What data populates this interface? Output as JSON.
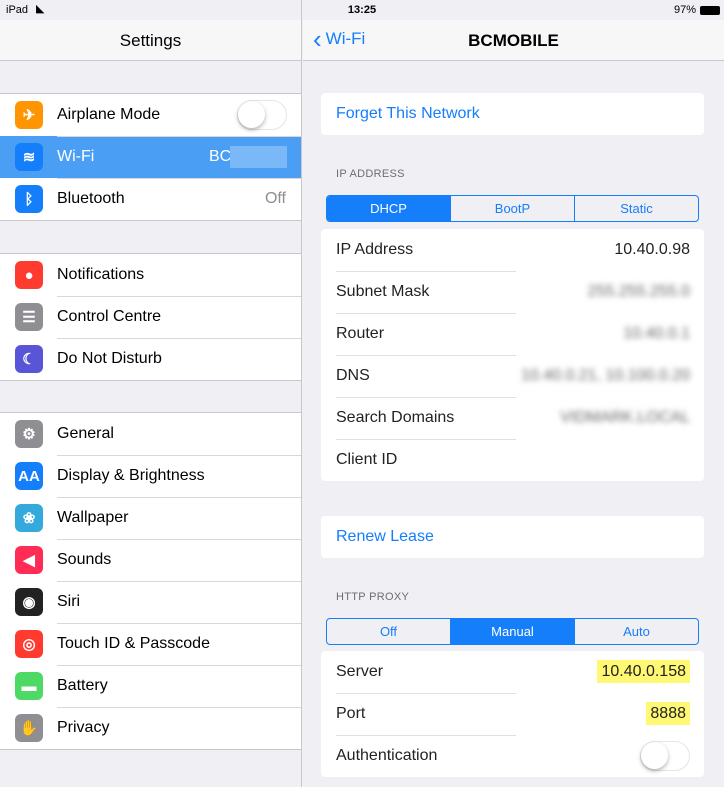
{
  "status": {
    "device": "iPad",
    "time": "13:25",
    "battery": "97%"
  },
  "left": {
    "title": "Settings",
    "groups": [
      [
        {
          "label": "Airplane Mode",
          "icon": "airplane-icon",
          "color": "#ff9500",
          "toggle": false
        },
        {
          "label": "Wi-Fi",
          "icon": "wifi-icon",
          "color": "#157efb",
          "value": "BC",
          "selected": true
        },
        {
          "label": "Bluetooth",
          "icon": "bluetooth-icon",
          "color": "#157efb",
          "value": "Off"
        }
      ],
      [
        {
          "label": "Notifications",
          "icon": "notifications-icon",
          "color": "#ff3b30"
        },
        {
          "label": "Control Centre",
          "icon": "control-centre-icon",
          "color": "#8e8e93"
        },
        {
          "label": "Do Not Disturb",
          "icon": "moon-icon",
          "color": "#5856d6"
        }
      ],
      [
        {
          "label": "General",
          "icon": "gear-icon",
          "color": "#8e8e93"
        },
        {
          "label": "Display & Brightness",
          "icon": "display-icon",
          "color": "#157efb"
        },
        {
          "label": "Wallpaper",
          "icon": "wallpaper-icon",
          "color": "#34aadc"
        },
        {
          "label": "Sounds",
          "icon": "speaker-icon",
          "color": "#ff2d55"
        },
        {
          "label": "Siri",
          "icon": "siri-icon",
          "color": "#222"
        },
        {
          "label": "Touch ID & Passcode",
          "icon": "fingerprint-icon",
          "color": "#ff3b30"
        },
        {
          "label": "Battery",
          "icon": "battery-icon",
          "color": "#4cd964"
        },
        {
          "label": "Privacy",
          "icon": "hand-icon",
          "color": "#8e8e93"
        }
      ]
    ]
  },
  "right": {
    "back": "Wi-Fi",
    "title": "BCMOBILE",
    "forget": "Forget This Network",
    "ip_header": "IP ADDRESS",
    "ip_modes": [
      "DHCP",
      "BootP",
      "Static"
    ],
    "ip_selected": 0,
    "ip_rows": [
      {
        "label": "IP Address",
        "value": "10.40.0.98"
      },
      {
        "label": "Subnet Mask",
        "value": "255.255.255.0",
        "blurred": true
      },
      {
        "label": "Router",
        "value": "10.40.0.1",
        "blurred": true
      },
      {
        "label": "DNS",
        "value": "10.40.0.21, 10.100.0.20",
        "blurred": true
      },
      {
        "label": "Search Domains",
        "value": "VIDMARK.LOCAL",
        "blurred": true
      },
      {
        "label": "Client ID",
        "value": ""
      }
    ],
    "renew": "Renew Lease",
    "proxy_header": "HTTP PROXY",
    "proxy_modes": [
      "Off",
      "Manual",
      "Auto"
    ],
    "proxy_selected": 1,
    "proxy_rows": [
      {
        "label": "Server",
        "value": "10.40.0.158",
        "highlight": true
      },
      {
        "label": "Port",
        "value": "8888",
        "highlight": true
      },
      {
        "label": "Authentication",
        "toggle": false
      }
    ]
  }
}
